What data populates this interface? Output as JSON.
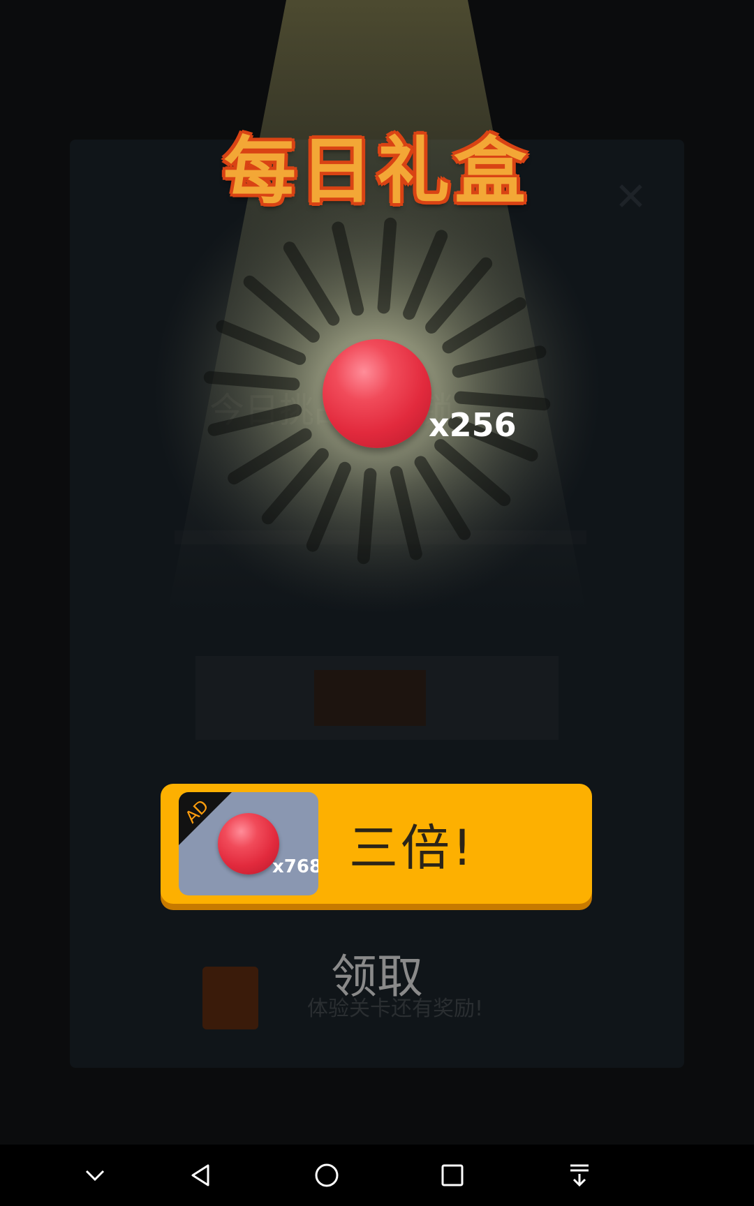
{
  "popup": {
    "title": "每日礼盒",
    "reward_count": "x256",
    "triple_button": {
      "ad_label": "AD",
      "ad_count": "x768",
      "label": "三倍!"
    },
    "claim_label": "领取"
  },
  "background": {
    "text_1": "今日挑战已解锁",
    "text_2": "体验关卡还有奖励!"
  },
  "nav_bar": {
    "buttons": [
      "chevron-down-icon",
      "back-icon",
      "home-icon",
      "recents-icon",
      "notification-pull-icon"
    ]
  },
  "colors": {
    "title": "#f3a736",
    "title_outline": "#d94314",
    "button": "#fdb001",
    "ball": "#e22a3d",
    "ad_card": "#8a97b1"
  }
}
